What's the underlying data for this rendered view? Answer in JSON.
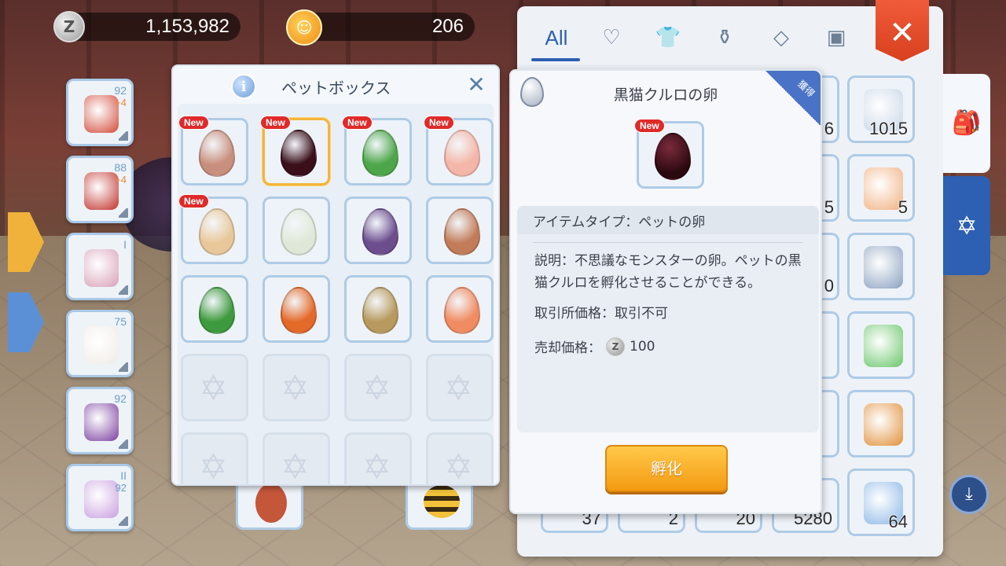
{
  "currency": {
    "zeny_icon": "Z",
    "zeny": "1,153,982",
    "gem": "206"
  },
  "left_equipment": [
    {
      "level": "92",
      "refine": "+4",
      "color": "#d24a3a"
    },
    {
      "level": "88",
      "refine": "+4",
      "color": "#c0302a"
    },
    {
      "level": "I",
      "refine": "",
      "color": "#d9a0b8"
    },
    {
      "level": "75",
      "refine": "",
      "color": "#f0ece6"
    },
    {
      "level": "92",
      "refine": "",
      "color": "#7b3fa0"
    },
    {
      "level": "II",
      "level2": "92",
      "refine": "",
      "color": "#c9a0e0"
    }
  ],
  "pet_box": {
    "title": "ペットボックス",
    "info_icon": "i",
    "close_icon": "✕",
    "new_label": "New",
    "eggs": [
      {
        "name": "egg-vine",
        "color": "#c98f7e",
        "new": true
      },
      {
        "name": "egg-black-cat",
        "color": "#3a0f1a",
        "new": true,
        "selected": true
      },
      {
        "name": "egg-green-spotted",
        "color": "#4ea64a",
        "new": true
      },
      {
        "name": "egg-pink-spotted",
        "color": "#f4b6a8",
        "new": true
      },
      {
        "name": "egg-dragon-gold",
        "color": "#e8c89a",
        "new": true
      },
      {
        "name": "egg-dragon-white",
        "color": "#dfe8d8",
        "new": false
      },
      {
        "name": "egg-purple",
        "color": "#6c4d8e",
        "new": false
      },
      {
        "name": "egg-brown",
        "color": "#c27c5a",
        "new": false
      },
      {
        "name": "egg-green-stripe",
        "color": "#3e9a3e",
        "new": false
      },
      {
        "name": "egg-red-gold",
        "color": "#e46a2a",
        "new": false
      },
      {
        "name": "egg-basket",
        "color": "#b89a5e",
        "new": false
      },
      {
        "name": "egg-orange-gloss",
        "color": "#f08c62",
        "new": false
      }
    ],
    "empty_icon": "✡"
  },
  "detail": {
    "title": "黒猫クルロの卵",
    "ribbon": "獲得",
    "new_label": "New",
    "item_type": "アイテムタイプ：ペットの卵",
    "description": "説明：不思議なモンスターの卵。ペットの黒猫クルロを孵化させることができる。",
    "trade": "取引所価格：取引不可",
    "sell_label": "売却価格：",
    "sell_coin": "Z",
    "sell_value": "100",
    "hatch_button": "孵化"
  },
  "inventory": {
    "tabs": [
      {
        "label": "All",
        "active": true
      },
      {
        "label": "♡",
        "active": false
      },
      {
        "label": "👕",
        "active": false
      },
      {
        "label": "⚱",
        "active": false
      },
      {
        "label": "◇",
        "active": false
      },
      {
        "label": "▣",
        "active": false
      }
    ],
    "close_icon": "✕",
    "partial_counts": [
      "6",
      "5",
      "0",
      "",
      "",
      ""
    ],
    "column_items": [
      {
        "count": "1015",
        "color": "#c8d6e6"
      },
      {
        "count": "5",
        "color": "#f0b080"
      },
      {
        "count": "",
        "color": "#8aa0c0"
      },
      {
        "count": "",
        "color": "#6bc66b"
      },
      {
        "count": "",
        "color": "#e0903a"
      },
      {
        "count": "64",
        "color": "#8ab6e6"
      }
    ],
    "bottom_counts": [
      "37",
      "2",
      "20",
      "5280"
    ],
    "side_tabs": [
      "bag",
      "card"
    ],
    "corner_button": "⤓"
  }
}
